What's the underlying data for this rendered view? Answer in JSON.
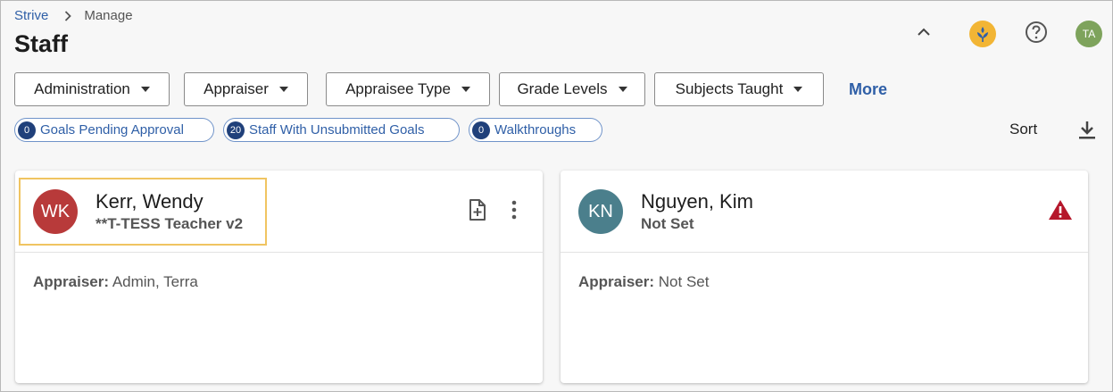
{
  "breadcrumb": {
    "home": "Strive",
    "current": "Manage"
  },
  "page": {
    "title": "Staff"
  },
  "header": {
    "avatar_initials": "TA"
  },
  "filters": [
    {
      "label": "Administration"
    },
    {
      "label": "Appraiser"
    },
    {
      "label": "Appraisee Type"
    },
    {
      "label": "Grade Levels"
    },
    {
      "label": "Subjects Taught"
    }
  ],
  "more_label": "More",
  "chips": [
    {
      "count": "0",
      "label": "Goals Pending Approval"
    },
    {
      "count": "20",
      "label": "Staff With Unsubmitted Goals"
    },
    {
      "count": "0",
      "label": "Walkthroughs"
    }
  ],
  "sort_label": "Sort",
  "cards": [
    {
      "initials": "WK",
      "name": "Kerr, Wendy",
      "rubric": "**T-TESS Teacher v2",
      "appraiser_label": "Appraiser:",
      "appraiser_value": "Admin, Terra",
      "avatar_color": "#b83a3a"
    },
    {
      "initials": "KN",
      "name": "Nguyen, Kim",
      "rubric": "Not Set",
      "appraiser_label": "Appraiser:",
      "appraiser_value": "Not Set",
      "avatar_color": "#4b7f8c"
    }
  ],
  "icons": {
    "collapse": "chevron-up-icon",
    "logo": "strive-logo-icon",
    "help": "help-icon",
    "download": "download-icon",
    "add_document": "add-document-icon",
    "more": "more-vertical-icon",
    "warning": "warning-icon"
  },
  "colors": {
    "accent": "#2f5fa7",
    "chip_count_bg": "#20407a",
    "highlight": "#f0c461",
    "warning": "#b5172b"
  }
}
